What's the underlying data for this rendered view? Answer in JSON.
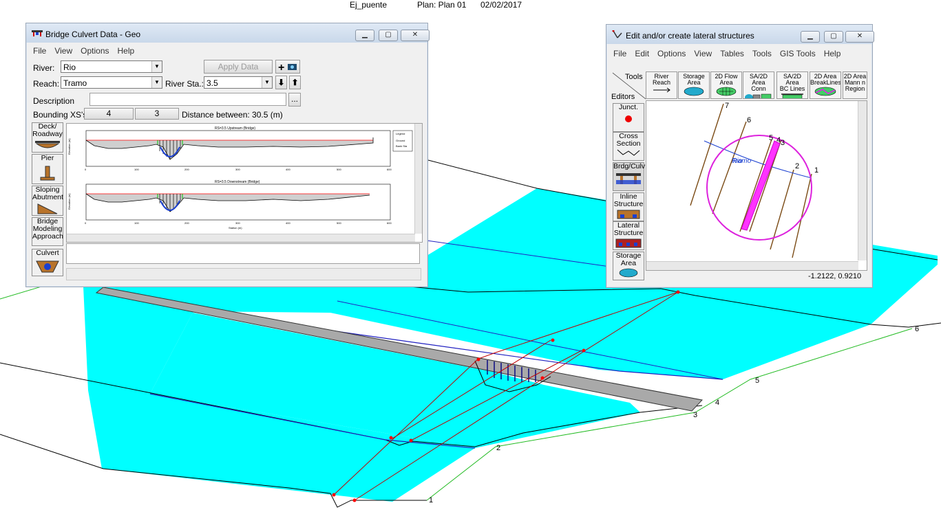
{
  "page_header": {
    "project": "Ej_puente",
    "plan": "Plan: Plan 01",
    "date": "02/02/2017"
  },
  "scene_labels": {
    "xs1": "1",
    "xs2": "2",
    "xs3": "3",
    "xs4": "4",
    "xs5": "5",
    "xs6": "6"
  },
  "bridge_window": {
    "title": "Bridge Culvert Data - Geo",
    "menu": [
      "File",
      "View",
      "Options",
      "Help"
    ],
    "river_label": "River:",
    "river_value": "Rio",
    "reach_label": "Reach:",
    "reach_value": "Tramo",
    "river_sta_label": "River Sta.:",
    "river_sta_value": "3.5",
    "apply_label": "Apply Data",
    "description_label": "Description",
    "desc_button": "...",
    "bounding_label": "Bounding XS's:",
    "bounding_xs": [
      "4",
      "3"
    ],
    "distance_text": "Distance between: 30.5 (m)",
    "side_buttons": {
      "deck": [
        "Deck/",
        "Roadway"
      ],
      "pier": [
        "Pier"
      ],
      "sloping": [
        "Sloping",
        "Abutment"
      ],
      "modeling": [
        "Bridge",
        "Modeling",
        "Approach"
      ],
      "culvert": [
        "Culvert"
      ]
    },
    "plot_upstream": {
      "title": "RS=3.5  Upstream (Bridge)",
      "ylabel": "Elevation (m)",
      "legend_title": "Legend",
      "legend_items": [
        "Ground",
        "Bank Sta"
      ]
    },
    "plot_downstream": {
      "title": "RS=3.5  Downstream (Bridge)",
      "ylabel": "Elevation (m)",
      "xlabel": "Station (m)"
    },
    "x_ticks": [
      "0",
      "100",
      "200",
      "300",
      "400",
      "500",
      "600"
    ]
  },
  "lateral_window": {
    "title": "Edit and/or create lateral structures",
    "menu": [
      "File",
      "Edit",
      "Options",
      "View",
      "Tables",
      "Tools",
      "GIS Tools",
      "Help"
    ],
    "tools_label": "Tools",
    "editors_label": "Editors",
    "tool_tabs": {
      "river_reach": [
        "River",
        "Reach"
      ],
      "storage": [
        "Storage",
        "Area"
      ],
      "flow_area": [
        "2D Flow",
        "Area"
      ],
      "sa_conn": [
        "SA/2D Area",
        "Conn"
      ],
      "bc_lines": [
        "SA/2D Area",
        "BC Lines"
      ],
      "break_lines": [
        "2D Area",
        "BreakLines"
      ],
      "mann": [
        "2D Area",
        "Mann n",
        "Region"
      ]
    },
    "editors": {
      "junct": [
        "Junct."
      ],
      "cross": [
        "Cross",
        "Section"
      ],
      "bridge": [
        "Brdg/Culv"
      ],
      "inline": [
        "Inline",
        "Structure"
      ],
      "lateral": [
        "Lateral",
        "Structure"
      ],
      "storage": [
        "Storage",
        "Area"
      ]
    },
    "map_labels": {
      "xs7": "7",
      "xs6": "6",
      "xs5": "5",
      "xs4": "4",
      "xs3": "3",
      "xs2": "2",
      "xs1": "1",
      "reach": "Tramo",
      "river": "Rio"
    },
    "coords": "-1.2122, 0.9210"
  }
}
